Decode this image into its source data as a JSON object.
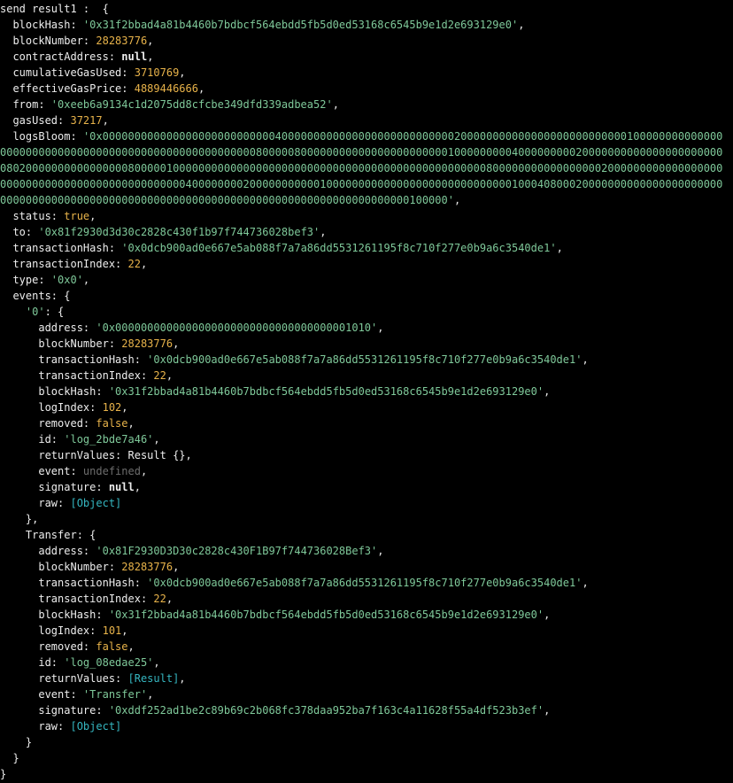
{
  "header": "send result1 :  {",
  "blockHash": "'0x31f2bbad4a81b4460b7bdbcf564ebdd5fb5d0ed53168c6545b9e1d2e693129e0'",
  "blockNumber": "28283776",
  "contractAddress": "null",
  "cumulativeGasUsed": "3710769",
  "effectiveGasPrice": "4889446666",
  "from": "'0xeeb6a9134c1d2075dd8cfcbe349dfd339adbea52'",
  "gasUsed": "37217",
  "logsBloom": "'0x00000000000000000000000000040000000000000000000000000002000000000000000000000000001000000000000000000000000000000000000000000000000000000800000800000000000000000000000100000000040000000002000000000000000000000008020000000000000000800000100000000000000000000000000000000000000000000000008000000000000000002000000000000000000000000000000000000000000000004000000002000000000001000000000000000000000000000001000408000200000000000000000000000000000000000000000000000000000000000000000000000000000000000000100000'",
  "status": "true",
  "to": "'0x81f2930d3d30c2828c430f1b97f744736028bef3'",
  "transactionHash": "'0x0dcb900ad0e667e5ab088f7a7a86dd5531261195f8c710f277e0b9a6c3540de1'",
  "transactionIndex": "22",
  "type": "'0x0'",
  "event0": {
    "key": "'0'",
    "address": "'0x0000000000000000000000000000000000001010'",
    "blockNumber": "28283776",
    "transactionHash": "'0x0dcb900ad0e667e5ab088f7a7a86dd5531261195f8c710f277e0b9a6c3540de1'",
    "transactionIndex": "22",
    "blockHash": "'0x31f2bbad4a81b4460b7bdbcf564ebdd5fb5d0ed53168c6545b9e1d2e693129e0'",
    "logIndex": "102",
    "removed": "false",
    "id": "'log_2bde7a46'",
    "returnValues": "Result {},",
    "event": "undefined",
    "signature": "null",
    "raw": "[Object]"
  },
  "transfer": {
    "key": "Transfer",
    "address": "'0x81F2930D3D30c2828c430F1B97f744736028Bef3'",
    "blockNumber": "28283776",
    "transactionHash": "'0x0dcb900ad0e667e5ab088f7a7a86dd5531261195f8c710f277e0b9a6c3540de1'",
    "transactionIndex": "22",
    "blockHash": "'0x31f2bbad4a81b4460b7bdbcf564ebdd5fb5d0ed53168c6545b9e1d2e693129e0'",
    "logIndex": "101",
    "removed": "false",
    "id": "'log_08edae25'",
    "returnValues": "[Result]",
    "event": "'Transfer'",
    "signature": "'0xddf252ad1be2c89b69c2b068fc378daa952ba7f163c4a11628f55a4df523b3ef'",
    "raw": "[Object]"
  }
}
